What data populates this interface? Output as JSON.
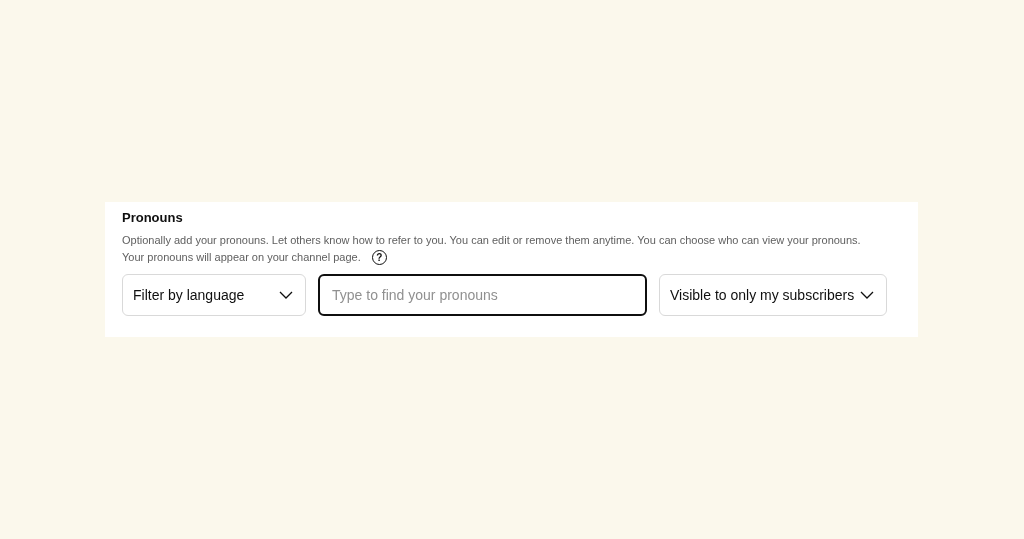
{
  "section": {
    "title": "Pronouns",
    "description_lines": [
      "Optionally add your pronouns. Let others know how to refer to you. You can edit or remove them anytime. You can choose who can view your pronouns.",
      "Your pronouns will appear on your channel page."
    ],
    "help_icon": "?",
    "language_filter": {
      "value": "Filter by language"
    },
    "search": {
      "placeholder": "Type to find your pronouns",
      "focused": true
    },
    "visibility": {
      "value": "Visible to only my subscribers"
    }
  }
}
